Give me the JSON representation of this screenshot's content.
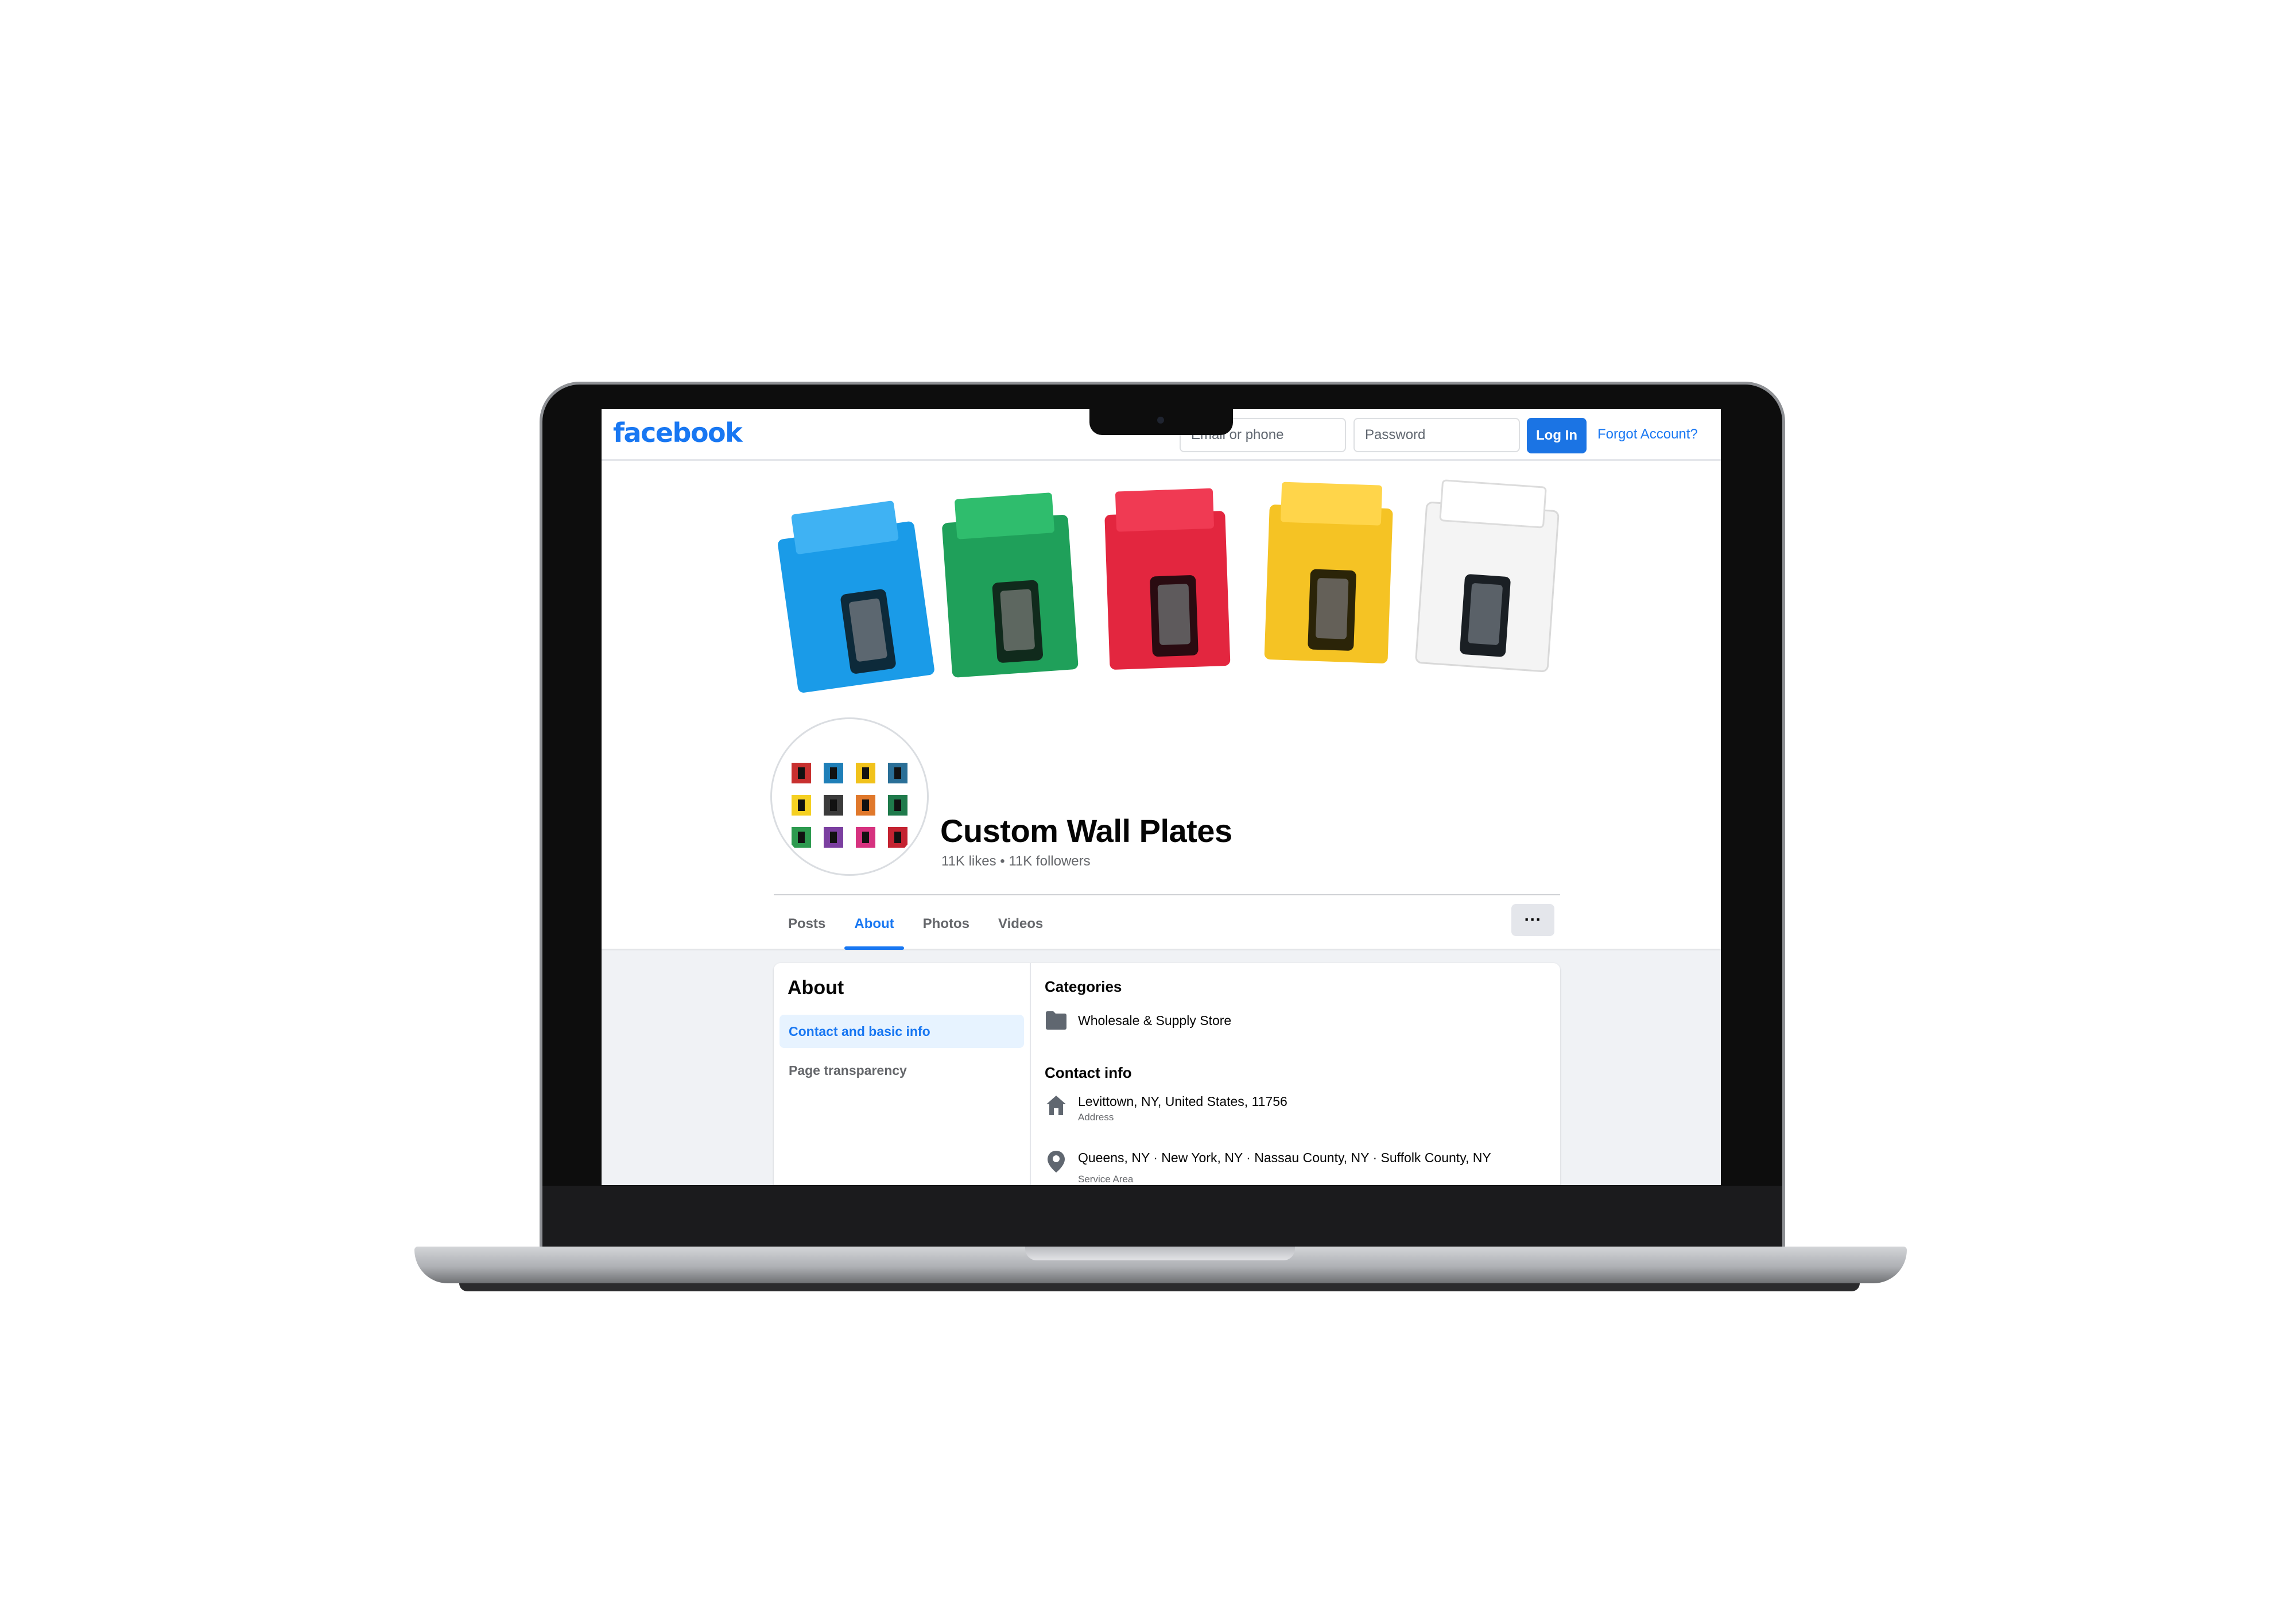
{
  "navbar": {
    "logo": "facebook",
    "email_placeholder": "Email or phone",
    "password_placeholder": "Password",
    "login_label": "Log In",
    "forgot_label": "Forgot Account?"
  },
  "profile": {
    "name": "Custom Wall Plates",
    "stats": "11K likes • 11K followers"
  },
  "tabs": [
    {
      "label": "Posts",
      "active": false
    },
    {
      "label": "About",
      "active": true
    },
    {
      "label": "Photos",
      "active": false
    },
    {
      "label": "Videos",
      "active": false
    }
  ],
  "more_label": "···",
  "about": {
    "title": "About",
    "nav": [
      {
        "label": "Contact and basic info",
        "active": true
      },
      {
        "label": "Page transparency",
        "active": false
      }
    ],
    "categories_title": "Categories",
    "category": "Wholesale & Supply Store",
    "contact_title": "Contact info",
    "address": "Levittown, NY, United States, 11756",
    "address_label": "Address",
    "service_area": "Queens, NY · New York, NY · Nassau County, NY · Suffolk County, NY",
    "service_area_label": "Service Area"
  },
  "colors": {
    "brand_blue": "#1877f2",
    "keystone_colors": [
      "#1a9be8",
      "#1fa05a",
      "#e3263f",
      "#f5c324",
      "#f4f4f4"
    ]
  },
  "icons": [
    "webcam-icon",
    "category-icon",
    "home-icon",
    "location-pin-icon"
  ]
}
